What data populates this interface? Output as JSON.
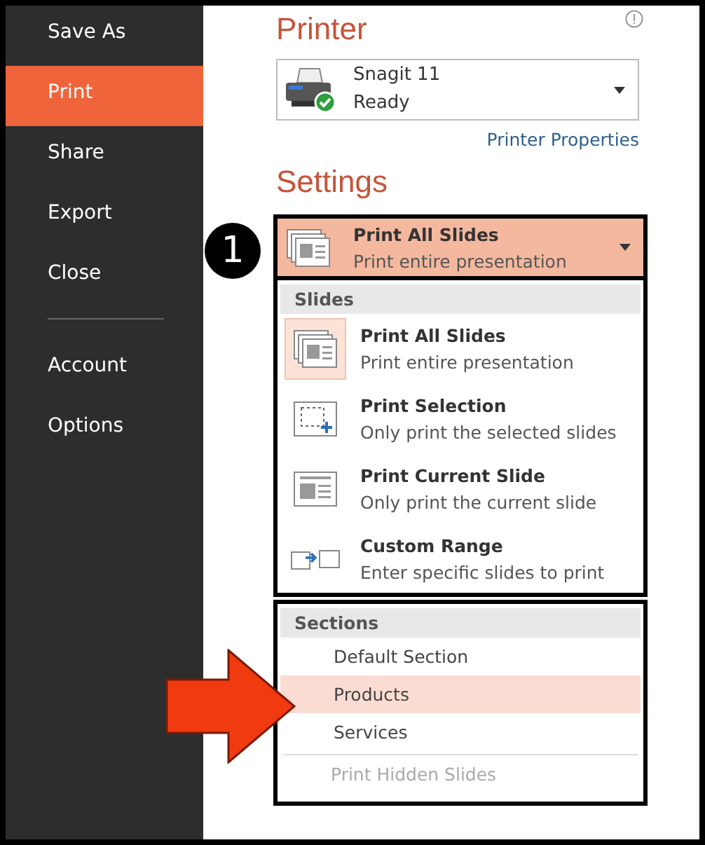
{
  "sidebar": {
    "items": [
      {
        "label": "Save As",
        "selected": false
      },
      {
        "label": "Print",
        "selected": true
      },
      {
        "label": "Share",
        "selected": false
      },
      {
        "label": "Export",
        "selected": false
      },
      {
        "label": "Close",
        "selected": false
      },
      {
        "label": "Account",
        "selected": false
      },
      {
        "label": "Options",
        "selected": false
      }
    ]
  },
  "printer": {
    "heading": "Printer",
    "name": "Snagit 11",
    "status": "Ready",
    "properties_link": "Printer Properties"
  },
  "settings": {
    "heading": "Settings",
    "callout": "1",
    "dropdown": {
      "kind": "all",
      "title": "Print All Slides",
      "subtitle": "Print entire presentation"
    },
    "slides_group": {
      "header": "Slides",
      "items": [
        {
          "kind": "all",
          "title": "Print All Slides",
          "subtitle": "Print entire presentation",
          "selected": true
        },
        {
          "kind": "selection",
          "title": "Print Selection",
          "subtitle": "Only print the selected slides",
          "selected": false
        },
        {
          "kind": "current",
          "title": "Print Current Slide",
          "subtitle": "Only print the current slide",
          "selected": false
        },
        {
          "kind": "range",
          "title": "Custom Range",
          "subtitle": "Enter specific slides to print",
          "selected": false
        }
      ]
    },
    "sections_group": {
      "header": "Sections",
      "items": [
        {
          "label": "Default Section",
          "selected": false
        },
        {
          "label": "Products",
          "selected": true
        },
        {
          "label": "Services",
          "selected": false
        }
      ],
      "hidden_slides": {
        "label": "Print Hidden Slides",
        "disabled": true
      }
    }
  }
}
